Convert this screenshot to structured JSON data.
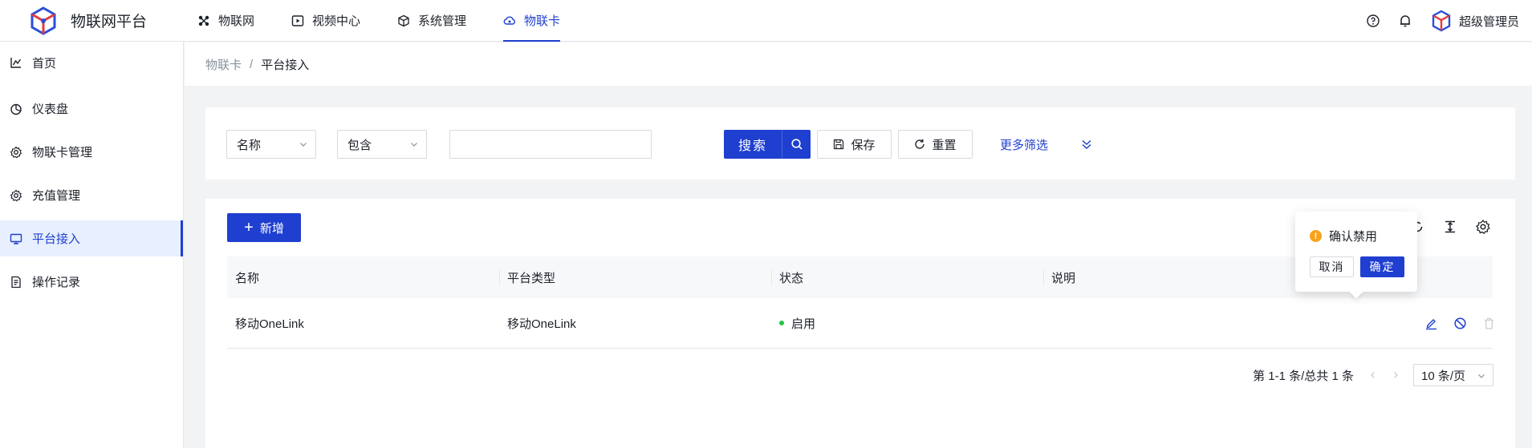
{
  "app": {
    "title": "物联网平台",
    "logo_icon": "cube-logo-icon"
  },
  "topnav": {
    "items": [
      {
        "label": "物联网",
        "icon": "nodes-icon"
      },
      {
        "label": "视频中心",
        "icon": "video-icon"
      },
      {
        "label": "系统管理",
        "icon": "box-icon"
      },
      {
        "label": "物联卡",
        "icon": "cloud-icon",
        "active": true
      }
    ]
  },
  "header": {
    "help_icon": "help-icon",
    "bell_icon": "bell-icon",
    "user_name": "超级管理员"
  },
  "sidebar": {
    "items": [
      {
        "label": "首页",
        "icon": "chart-icon"
      },
      {
        "label": "仪表盘",
        "icon": "pie-icon"
      },
      {
        "label": "物联卡管理",
        "icon": "gear-icon"
      },
      {
        "label": "充值管理",
        "icon": "gear-icon"
      },
      {
        "label": "平台接入",
        "icon": "monitor-icon",
        "active": true
      },
      {
        "label": "操作记录",
        "icon": "doc-icon"
      }
    ]
  },
  "breadcrumb": {
    "parent": "物联卡",
    "separator": "/",
    "current": "平台接入"
  },
  "filter": {
    "field_select": "名称",
    "operator_select": "包含",
    "value_placeholder": "",
    "search_label": "搜索",
    "save_label": "保存",
    "reset_label": "重置",
    "more_label": "更多筛选"
  },
  "table": {
    "add_label": "新增",
    "columns": [
      "名称",
      "平台类型",
      "状态",
      "说明"
    ],
    "rows": [
      {
        "name": "移动OneLink",
        "platform": "移动OneLink",
        "status": "启用",
        "desc": ""
      }
    ]
  },
  "pagination": {
    "summary": "第 1-1 条/总共 1 条",
    "page_size": "10 条/页"
  },
  "popconfirm": {
    "title": "确认禁用",
    "cancel_label": "取消",
    "ok_label": "确定"
  },
  "colors": {
    "primary": "#1f3fd0",
    "status_enabled": "#23c343",
    "warning": "#f7a21a"
  }
}
